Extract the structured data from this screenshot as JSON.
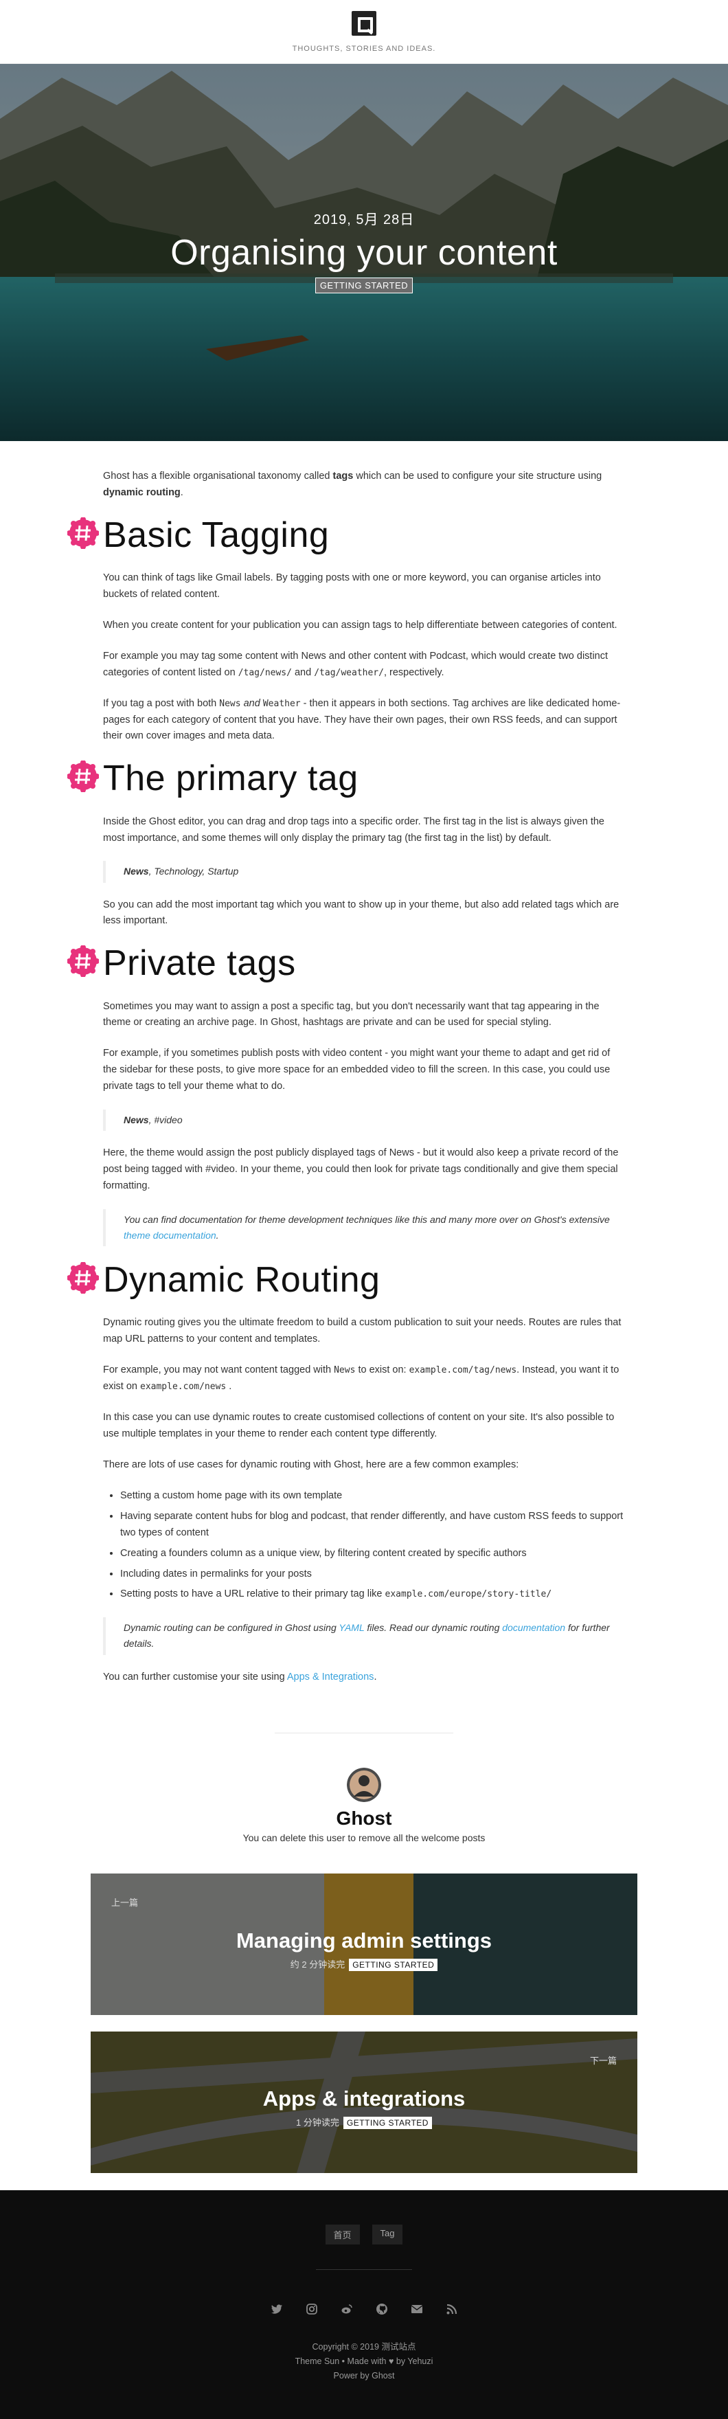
{
  "header": {
    "tagline": "THOUGHTS, STORIES AND IDEAS."
  },
  "hero": {
    "date": "2019, 5月 28日",
    "title": "Organising your content",
    "tag": "GETTING STARTED"
  },
  "article": {
    "intro": {
      "a": "Ghost has a flexible organisational taxonomy called ",
      "b": "tags",
      "c": " which can be used to configure your site structure using ",
      "d": "dynamic routing",
      "e": "."
    },
    "s1": {
      "heading": "Basic Tagging",
      "p1": "You can think of tags like Gmail labels. By tagging posts with one or more keyword, you can organise articles into buckets of related content.",
      "p2": "When you create content for your publication you can assign tags to help differentiate between categories of content.",
      "p3a": "For example you may tag some content with  News and other content with Podcast, which would create two distinct categories of content listed on ",
      "p3code1": "/tag/news/",
      "p3b": " and ",
      "p3code2": "/tag/weather/",
      "p3c": ", respectively.",
      "p4a": "If you tag a post with both ",
      "p4code1": "News",
      "p4and": " and ",
      "p4code2": "Weather",
      "p4b": " - then it appears in both sections. Tag archives are like dedicated home-pages for each category of content that you have. They have their own pages, their own RSS feeds, and can support their own cover images and meta data."
    },
    "s2": {
      "heading": "The primary tag",
      "p1": "Inside the Ghost editor, you can drag and drop tags into a specific order. The first tag in the list is always given the most importance, and some themes will only display the primary tag (the first tag in the list) by default.",
      "quote_bold": "News",
      "quote_rest": ", Technology, Startup",
      "p2": "So you can add the most important tag which you want to show up in your theme, but also add related tags which are less important."
    },
    "s3": {
      "heading": "Private tags",
      "p1": "Sometimes you may want to assign a post a specific tag, but you don't necessarily want that tag appearing in the theme or creating an archive page. In Ghost, hashtags are private and can be used for special styling.",
      "p2": "For example, if you sometimes publish posts with video content - you might want your theme to adapt and get rid of the sidebar for these posts, to give more space for an embedded video to fill the screen. In this case, you could use private tags to tell your theme what to do.",
      "quote_bold": "News",
      "quote_rest": ", #video",
      "p3": "Here, the theme would assign the post publicly displayed tags of News - but it would also keep a private record of the post being tagged with #video. In your theme, you could then look for private tags conditionally and give them special formatting.",
      "note_a": "You can find documentation for theme development techniques like this and many more over on Ghost's extensive ",
      "note_link": "theme documentation",
      "note_b": "."
    },
    "s4": {
      "heading": "Dynamic Routing",
      "p1": "Dynamic routing gives you the ultimate freedom to build a custom publication to suit your needs. Routes are rules that map URL patterns to your content and templates.",
      "p2a": "For example, you may not want content tagged with ",
      "p2code1": "News",
      "p2b": " to exist on: ",
      "p2code2": "example.com/tag/news",
      "p2c": ". Instead, you want it to exist on ",
      "p2code3": "example.com/news",
      "p2d": " .",
      "p3": "In this case you can use dynamic routes to create customised collections of content on your site. It's also possible to use multiple templates in your theme to render each content type differently.",
      "p4": "There are lots of use cases for dynamic routing with Ghost, here are a few common examples:",
      "list": [
        "Setting a custom home page with its own template",
        "Having separate content hubs for blog and podcast, that render differently, and have custom RSS feeds to support two types of content",
        "Creating a founders column as a unique view, by filtering content created by specific authors",
        "Including dates in permalinks for your posts"
      ],
      "list_last_a": "Setting posts to have a URL relative to their primary tag like ",
      "list_last_code": "example.com/europe/story-title/",
      "note_a": "Dynamic routing can be configured in Ghost using ",
      "note_link1": "YAML",
      "note_b": " files. Read our dynamic routing ",
      "note_link2": "documentation",
      "note_c": " for further details.",
      "p5a": "You can further customise your site using ",
      "p5link": "Apps & Integrations",
      "p5b": "."
    }
  },
  "author": {
    "name": "Ghost",
    "bio": "You can delete this user to remove all the welcome posts"
  },
  "prev_post": {
    "label": "上一篇",
    "title": "Managing admin settings",
    "meta": "约 2 分钟读完",
    "tag": "GETTING STARTED"
  },
  "next_post": {
    "label": "下一篇",
    "title": "Apps & integrations",
    "meta": "1 分钟读完",
    "tag": "GETTING STARTED"
  },
  "footer": {
    "nav": [
      "首页",
      "Tag"
    ],
    "social_icons": [
      "twitter-icon",
      "instagram-icon",
      "weibo-icon",
      "github-icon",
      "mail-icon",
      "rss-icon"
    ],
    "copyright": "Copyright © 2019 测试站点",
    "theme": "Theme Sun • Made with ♥ by Yehuzi",
    "powered": "Power by Ghost"
  },
  "colors": {
    "hash_badge": "#e8327c",
    "link": "#3aa3dc",
    "footer_bg": "#0d0d0d"
  }
}
